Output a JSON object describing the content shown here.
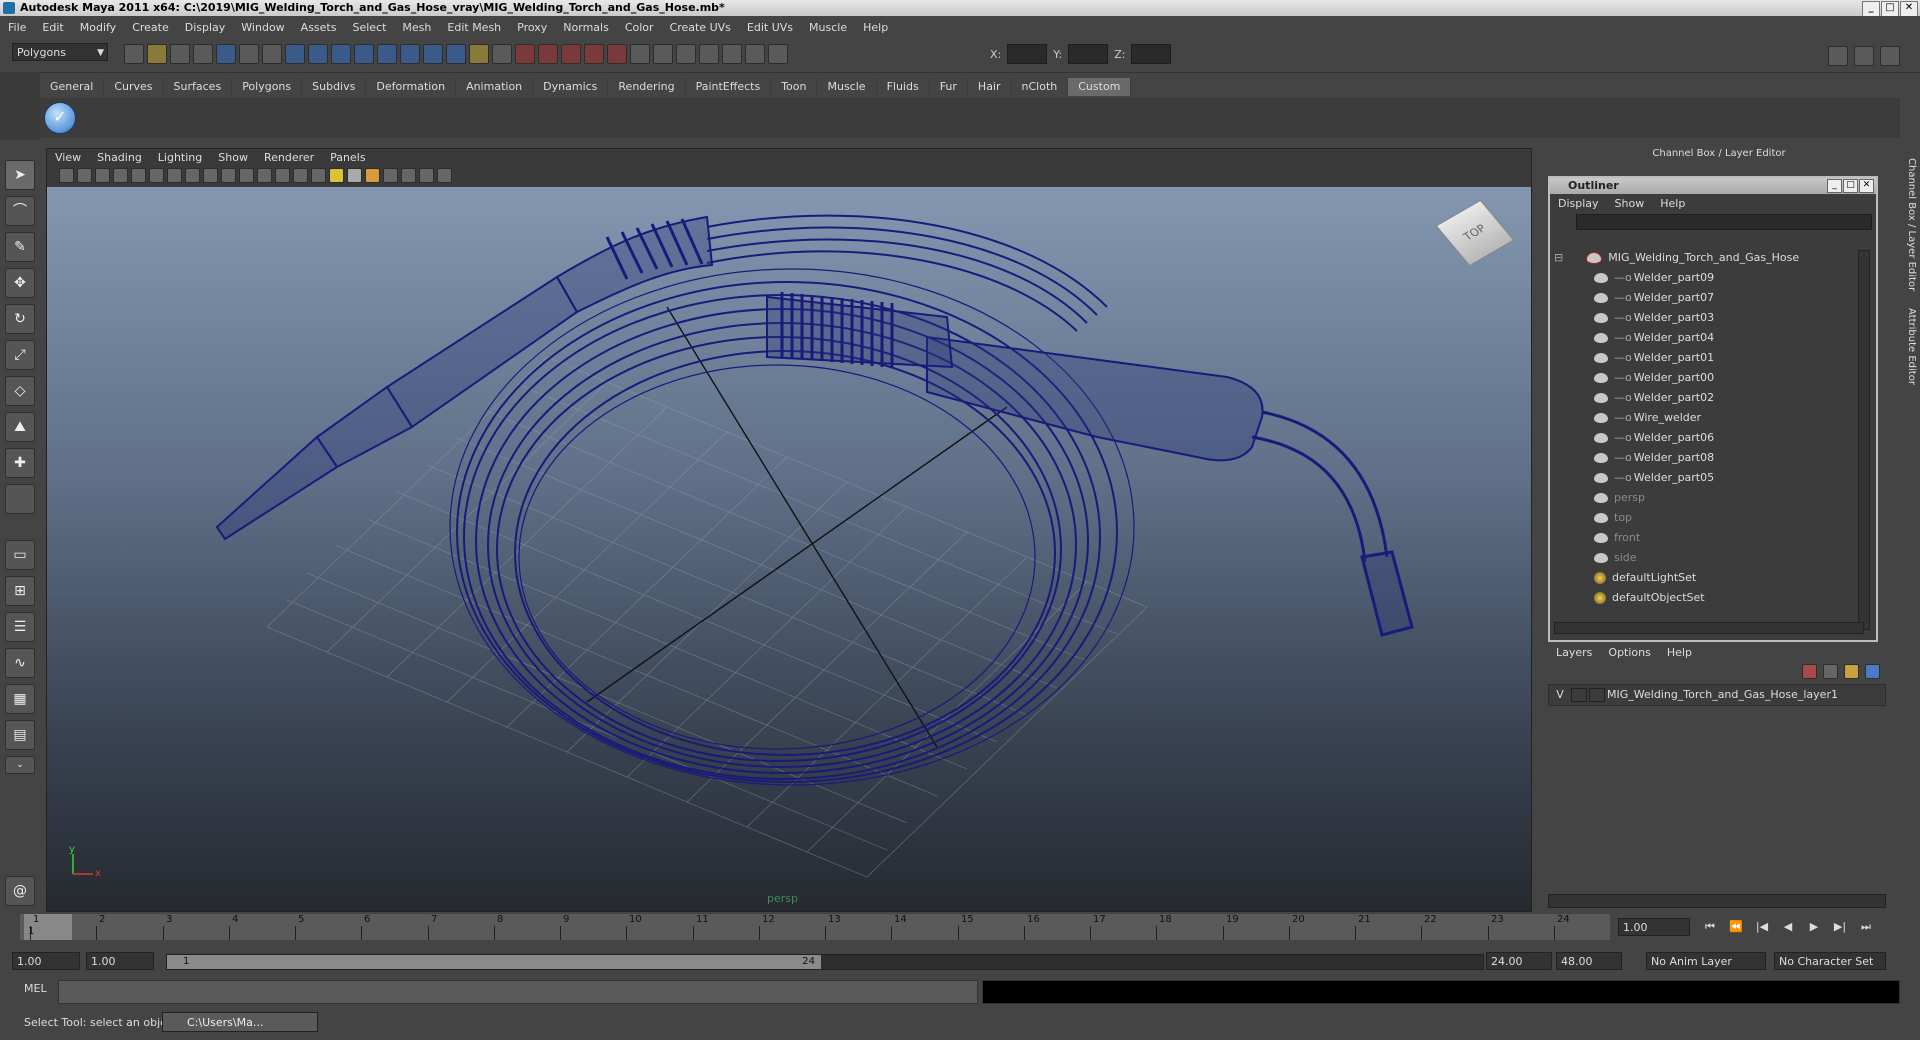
{
  "window": {
    "title": "Autodesk Maya 2011 x64: C:\\2019\\MIG_Welding_Torch_and_Gas_Hose_vray\\MIG_Welding_Torch_and_Gas_Hose.mb*"
  },
  "menus": [
    "File",
    "Edit",
    "Modify",
    "Create",
    "Display",
    "Window",
    "Assets",
    "Select",
    "Mesh",
    "Edit Mesh",
    "Proxy",
    "Normals",
    "Color",
    "Create UVs",
    "Edit UVs",
    "Muscle",
    "Help"
  ],
  "status": {
    "mode": "Polygons",
    "x_label": "X:",
    "y_label": "Y:",
    "z_label": "Z:"
  },
  "shelf_tabs": [
    "General",
    "Curves",
    "Surfaces",
    "Polygons",
    "Subdivs",
    "Deformation",
    "Animation",
    "Dynamics",
    "Rendering",
    "PaintEffects",
    "Toon",
    "Muscle",
    "Fluids",
    "Fur",
    "Hair",
    "nCloth",
    "Custom"
  ],
  "shelf_active": "Custom",
  "viewport": {
    "menus": [
      "View",
      "Shading",
      "Lighting",
      "Show",
      "Renderer",
      "Panels"
    ],
    "camera": "persp",
    "viewcube": "TOP",
    "wire_color": "#1a1a7a",
    "axis_y": "y",
    "axis_x": "x"
  },
  "right_panel": {
    "header": "Channel Box / Layer Editor",
    "side_tabs": [
      "Channel Box / Layer Editor",
      "Attribute Editor"
    ]
  },
  "outliner": {
    "title": "Outliner",
    "menus": [
      "Display",
      "Show",
      "Help"
    ],
    "root": "MIG_Welding_Torch_and_Gas_Hose",
    "children": [
      "Welder_part09",
      "Welder_part07",
      "Welder_part03",
      "Welder_part04",
      "Welder_part01",
      "Welder_part00",
      "Welder_part02",
      "Wire_welder",
      "Welder_part06",
      "Welder_part08",
      "Welder_part05"
    ],
    "cameras": [
      "persp",
      "top",
      "front",
      "side"
    ],
    "sets": [
      "defaultLightSet",
      "defaultObjectSet"
    ]
  },
  "layers": {
    "menus": [
      "Layers",
      "Options",
      "Help"
    ],
    "row": {
      "visible": "V",
      "name": "MIG_Welding_Torch_and_Gas_Hose_layer1"
    }
  },
  "timeline": {
    "ticks": [
      "1",
      "2",
      "3",
      "4",
      "5",
      "6",
      "7",
      "8",
      "9",
      "10",
      "11",
      "12",
      "13",
      "14",
      "15",
      "16",
      "17",
      "18",
      "19",
      "20",
      "21",
      "22",
      "23",
      "24"
    ],
    "current_frame_marker": "1",
    "current_frame": "1.00",
    "play_buttons": [
      "⏮",
      "⏪",
      "|◀",
      "◀",
      "▶",
      "▶|",
      "⏭"
    ]
  },
  "range": {
    "start": "1.00",
    "playback_start": "1.00",
    "handle_left": "1",
    "handle_right": "24",
    "playback_end": "24.00",
    "end": "48.00",
    "anim_layer": "No Anim Layer",
    "character_set": "No Character Set"
  },
  "command": {
    "label": "MEL"
  },
  "help": {
    "text": "Select Tool: select an object",
    "task": "C:\\Users\\Ma..."
  }
}
